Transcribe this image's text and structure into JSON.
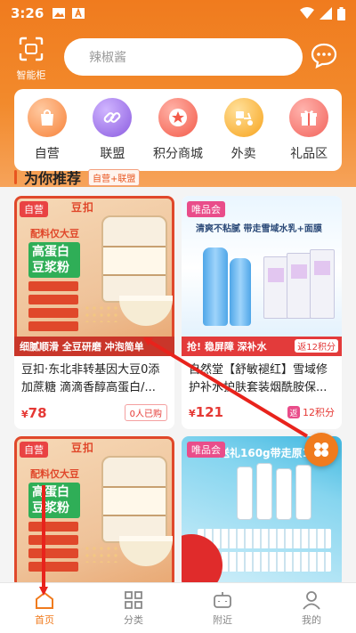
{
  "status_bar": {
    "time": "3:26"
  },
  "header": {
    "smart_cabinet_label": "智能柜",
    "search_placeholder": "辣椒酱"
  },
  "categories": [
    {
      "label": "自营",
      "color": "#f7823a"
    },
    {
      "label": "联盟",
      "color": "#8b5ce0"
    },
    {
      "label": "积分商城",
      "color": "#f35b4a"
    },
    {
      "label": "外卖",
      "color": "#f7a31c"
    },
    {
      "label": "礼品区",
      "color": "#f2635b"
    }
  ],
  "section": {
    "title": "为你推荐",
    "badge": "自营+联盟"
  },
  "products": [
    {
      "tag": "自营",
      "brand": "豆扣",
      "sub": "配料仅大豆",
      "main": "高蛋白豆浆粉",
      "banner": "细腻顺滑  全豆研磨  冲泡简单",
      "title": "豆扣·东北非转基因大豆0添加蔗糖 滴滴香醇高蛋白/...",
      "price": "78",
      "sold": "0人已购"
    },
    {
      "tag": "唯品会",
      "headline": "清爽不粘腻 带走雪域水乳+面膜",
      "banner": "抢! 稳屏障 深补水",
      "back_badge": "返12积分",
      "title": "自然堂【舒敏褪红】雪域修护补水护肤套装烟酰胺保...",
      "price": "121",
      "points": "12积分"
    },
    {
      "tag": "自营",
      "brand": "豆扣",
      "sub": "配料仅大豆",
      "main": "高蛋白豆浆粉"
    },
    {
      "tag": "唯品会",
      "headline": "送礼160g带走原1"
    }
  ],
  "bottom_nav": [
    {
      "label": "首页",
      "active": true
    },
    {
      "label": "分类",
      "active": false
    },
    {
      "label": "附近",
      "active": false
    },
    {
      "label": "我的",
      "active": false
    }
  ],
  "colors": {
    "brand": "#f07b1e",
    "price": "#e53935"
  }
}
